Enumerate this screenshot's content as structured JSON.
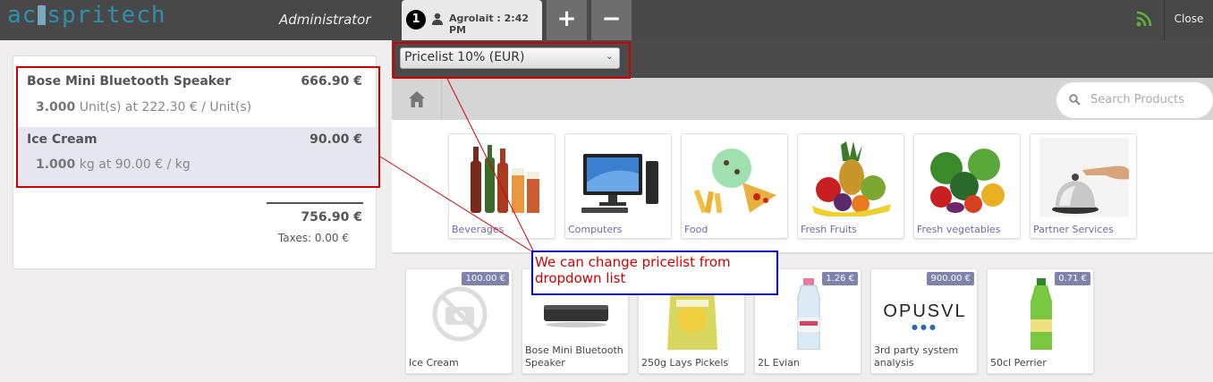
{
  "header": {
    "logo": "acespritech",
    "user": "Administrator",
    "order_number": "1",
    "order_label": "Agrolait : 2:42 PM",
    "add_label": "+",
    "remove_label": "−",
    "close_label": "Close"
  },
  "order": {
    "lines": [
      {
        "name": "Bose Mini Bluetooth Speaker",
        "price": "666.90 €",
        "qty": "3.000",
        "unit_info": "Unit(s) at 222.30 € / Unit(s)"
      },
      {
        "name": "Ice Cream",
        "price": "90.00 €",
        "qty": "1.000",
        "unit_info": "kg at 90.00 € / kg"
      }
    ],
    "total": "756.90 €",
    "taxes": "Taxes: 0.00 €"
  },
  "pricelist": {
    "selected": "Pricelist 10% (EUR)"
  },
  "search": {
    "placeholder": "Search Products"
  },
  "categories": [
    {
      "label": "Beverages",
      "icon": "beverages-icon"
    },
    {
      "label": "Computers",
      "icon": "computer-icon"
    },
    {
      "label": "Food",
      "icon": "food-icon"
    },
    {
      "label": "Fresh Fruits",
      "icon": "fruits-icon"
    },
    {
      "label": "Fresh vegetables",
      "icon": "vegetables-icon"
    },
    {
      "label": "Partner Services",
      "icon": "bell-icon"
    }
  ],
  "products": [
    {
      "name": "Ice Cream",
      "price": "100.00 €"
    },
    {
      "name": "Bose Mini Bluetooth Speaker",
      "price": ""
    },
    {
      "name": "250g Lays Pickels",
      "price": ""
    },
    {
      "name": "2L Evian",
      "price": "1.26 €"
    },
    {
      "name": "3rd party system analysis",
      "price": "900.00 €",
      "logo_text": "OPUSVL"
    },
    {
      "name": "50cl Perrier",
      "price": "0.71 €"
    }
  ],
  "annotation": {
    "text": "We can change pricelist from dropdown list"
  },
  "colors": {
    "accent": "#7f82ac",
    "annotation_red": "#d40000",
    "annotation_blue": "#0000cc"
  }
}
